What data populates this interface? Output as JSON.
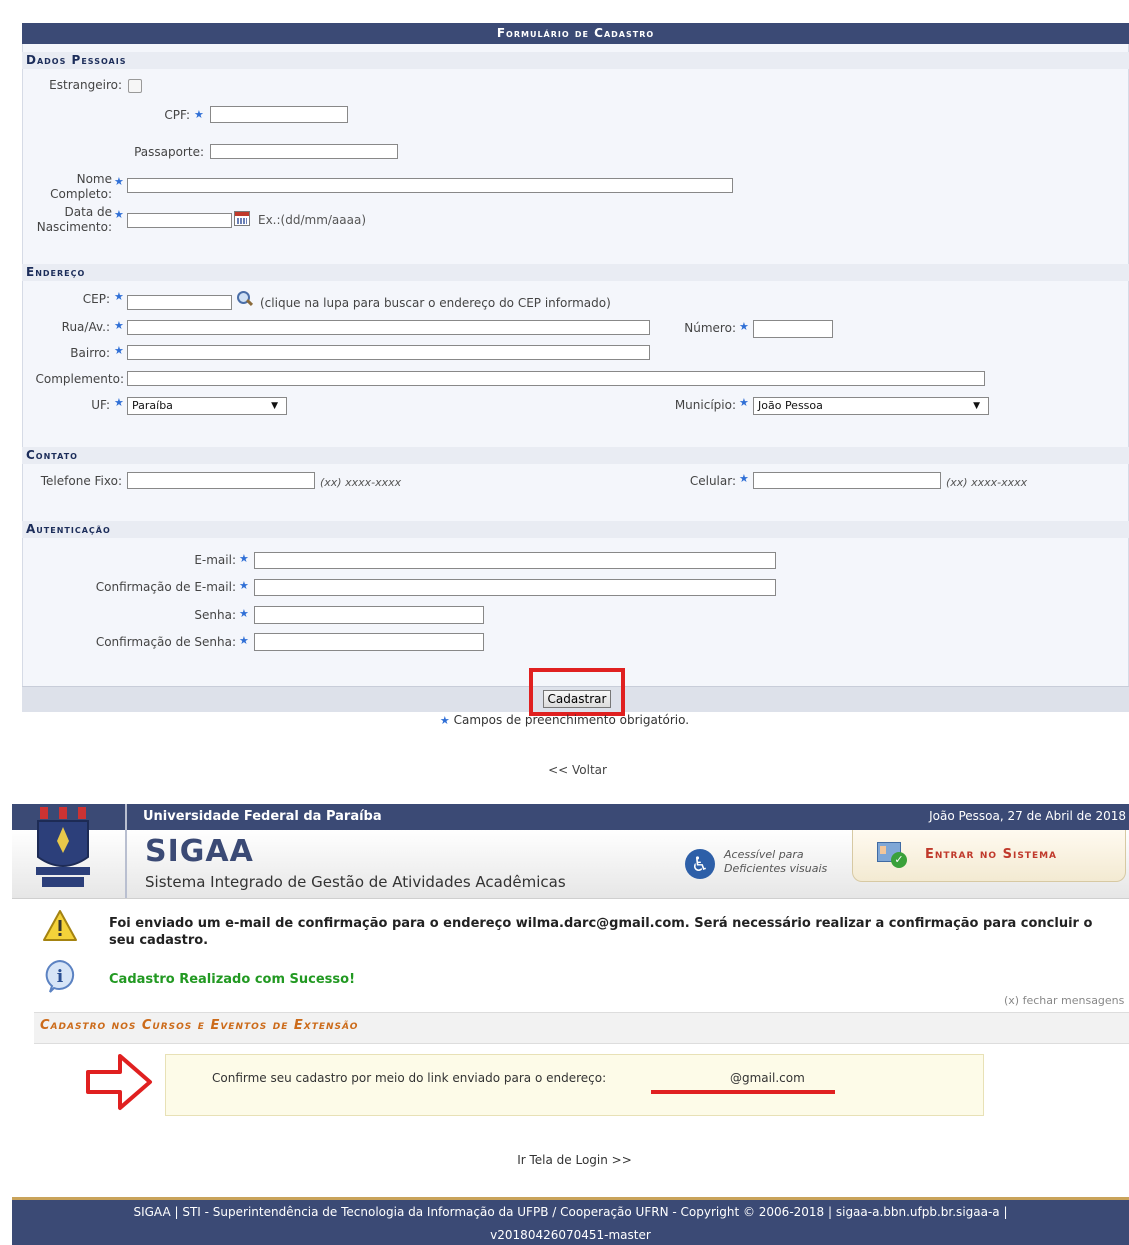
{
  "form": {
    "title": "Formulário de Cadastro",
    "sections": {
      "personal": "Dados Pessoais",
      "address": "Endereço",
      "contact": "Contato",
      "auth": "Autenticação"
    },
    "labels": {
      "foreign": "Estrangeiro:",
      "cpf": "CPF:",
      "passport": "Passaporte:",
      "name_line1": "Nome",
      "name_line2": "Completo:",
      "birth_line1": "Data de",
      "birth_line2": "Nascimento:",
      "birth_hint": "Ex.:(dd/mm/aaaa)",
      "cep": "CEP:",
      "cep_hint": "(clique na lupa para buscar o endereço do CEP informado)",
      "street": "Rua/Av.:",
      "number": "Número:",
      "district": "Bairro:",
      "complement": "Complemento:",
      "uf": "UF:",
      "city": "Município:",
      "phone": "Telefone Fixo:",
      "phone_hint": "(xx) xxxx-xxxx",
      "mobile": "Celular:",
      "mobile_hint": "(xx) xxxx-xxxx",
      "email": "E-mail:",
      "email_confirm": "Confirmação de E-mail:",
      "password": "Senha:",
      "password_confirm": "Confirmação de Senha:"
    },
    "values": {
      "uf": "Paraíba",
      "city": "João Pessoa"
    },
    "submit_label": "Cadastrar",
    "required_note": "Campos de preenchimento obrigatório.",
    "back_link": "<< Voltar"
  },
  "sigaa": {
    "university": "Universidade Federal da Paraíba",
    "date": "João Pessoa, 27 de Abril de 2018",
    "app_name": "SIGAA",
    "app_subtitle": "Sistema Integrado de Gestão de Atividades Acadêmicas",
    "accessibility_line1": "Acessível para",
    "accessibility_line2": "Deficientes visuais",
    "login_button": "Entrar no Sistema",
    "warning_message": "Foi enviado um e-mail de confirmação para o endereço wilma.darc@gmail.com. Será necessário realizar a confirmação para concluir o seu cadastro.",
    "success_message": "Cadastro Realizado com Sucesso!",
    "close_messages": "(x) fechar mensagens",
    "section_title": "Cadastro nos Cursos e Eventos de Extensão",
    "confirm_text": "Confirme seu cadastro por meio do link enviado para o endereço:",
    "confirm_email": "@gmail.com",
    "login_link": "Ir Tela de Login >>",
    "footer_line1": "SIGAA | STI - Superintendência de Tecnologia da Informação da UFPB / Cooperação UFRN - Copyright © 2006-2018 | sigaa-a.bbn.ufpb.br.sigaa-a |",
    "footer_line2": "v20180426070451-master"
  },
  "colors": {
    "header_navy": "#3b4a75",
    "section_bg": "#e9ecf3",
    "highlight_red": "#e02020",
    "success_green": "#229922",
    "extension_orange": "#cc6b1a",
    "confirm_bg": "#fdfbe8"
  },
  "icons": [
    "checkbox-icon",
    "required-star-icon",
    "calendar-icon",
    "magnifier-icon",
    "crest-icon",
    "accessibility-icon",
    "login-icon",
    "warning-icon",
    "info-icon",
    "arrow-icon"
  ]
}
